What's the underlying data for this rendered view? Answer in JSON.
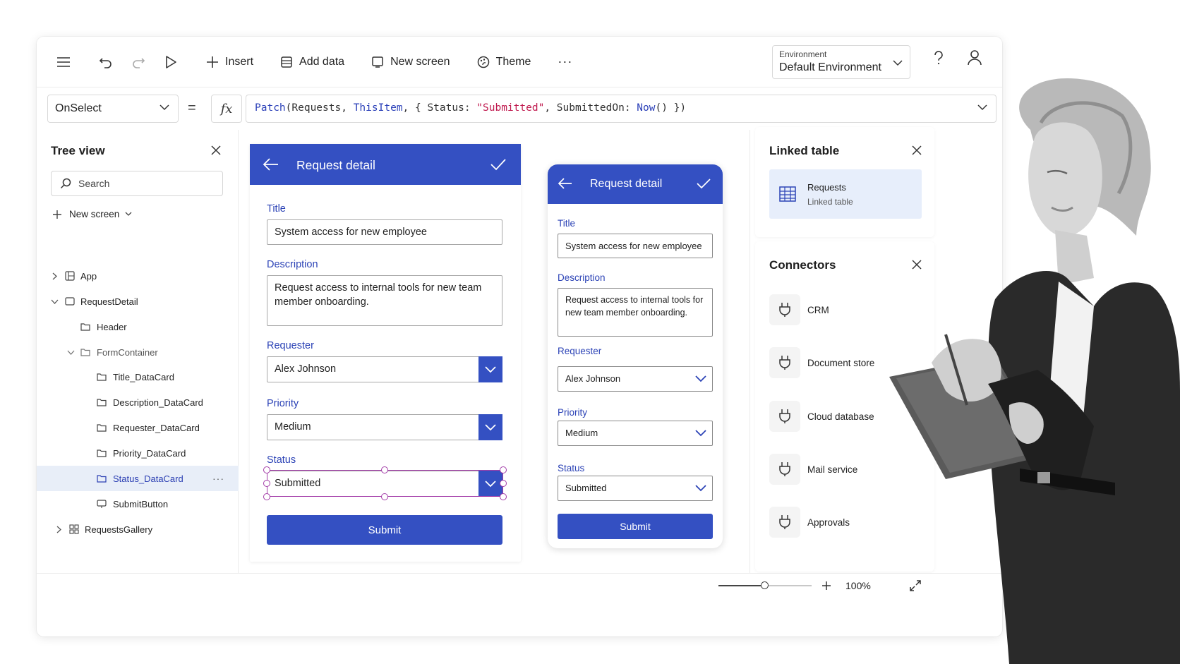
{
  "toolbar": {
    "menu_icon": "hamburger-icon",
    "undo_icon": "undo-icon",
    "redo_icon": "redo-icon",
    "play_icon": "play-icon",
    "insert_label": "Insert",
    "add_data_label": "Add data",
    "new_screen_label": "New screen",
    "theme_label": "Theme",
    "more_label": "···",
    "environment_label": "Environment",
    "environment_value": "Default Environment",
    "help_label": "?"
  },
  "formula_bar": {
    "property": "OnSelect",
    "equals": "=",
    "fx": "fx",
    "tokens": {
      "t1": "Patch",
      "t2": "(Requests, ",
      "t3": "ThisItem",
      "t4": ", { Status: ",
      "t5": "\"Submitted\"",
      "t6": ", SubmittedOn: ",
      "t7": "Now",
      "t8": "() })"
    }
  },
  "tree_view": {
    "title": "Tree view",
    "search_placeholder": "Search",
    "new_screen_label": "New screen",
    "items": [
      {
        "label": "App"
      },
      {
        "label": "RequestDetail"
      },
      {
        "label": "Header"
      },
      {
        "label": "FormContainer"
      },
      {
        "label": "Title_DataCard"
      },
      {
        "label": "Description_DataCard"
      },
      {
        "label": "Requester_DataCard"
      },
      {
        "label": "Priority_DataCard"
      },
      {
        "label": "Status_DataCard",
        "selected": true,
        "more": "···"
      },
      {
        "label": "SubmitButton"
      },
      {
        "label": "RequestsGallery"
      }
    ]
  },
  "form_desktop": {
    "header_title": "Request detail",
    "title_label": "Title",
    "title_value": "System access for new employee",
    "description_label": "Description",
    "description_value": "Request access to internal tools for new team member onboarding.",
    "requester_label": "Requester",
    "requester_value": "Alex Johnson",
    "priority_label": "Priority",
    "priority_value": "Medium",
    "status_label": "Status",
    "status_value": "Submitted",
    "submit_label": "Submit"
  },
  "form_mobile": {
    "header_title": "Request detail",
    "title_label": "Title",
    "title_value": "System access for new employee",
    "description_label": "Description",
    "description_value": "Request access to internal tools for new team member onboarding.",
    "requester_label": "Requester",
    "requester_value": "Alex Johnson",
    "priority_label": "Priority",
    "priority_value": "Medium",
    "status_label": "Status",
    "status_value": "Submitted",
    "submit_label": "Submit"
  },
  "linked_table": {
    "title": "Linked table",
    "table_name": "Requests",
    "table_subtitle": "Linked table"
  },
  "connectors": {
    "title": "Connectors",
    "items": [
      {
        "label": "CRM",
        "icon": "plug-icon"
      },
      {
        "label": "Document store",
        "icon": "plug-icon"
      },
      {
        "label": "Cloud database",
        "icon": "plug-icon"
      },
      {
        "label": "Mail service",
        "icon": "plug-icon"
      },
      {
        "label": "Approvals",
        "icon": "plug-icon"
      }
    ]
  },
  "status_bar": {
    "zoom_value": "100%",
    "zoom_level": 0.5
  },
  "colors": {
    "accent": "#3450c2",
    "label_blue": "#2c43b6",
    "selection": "#a33ca8",
    "selected_row_bg": "#e8eef8"
  }
}
